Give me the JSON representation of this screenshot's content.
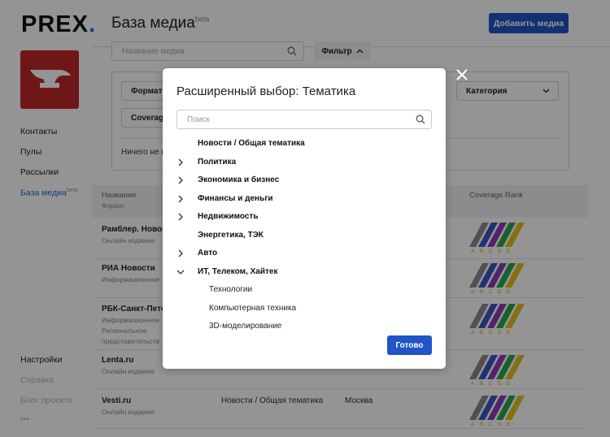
{
  "app": {
    "logo_text": "PREX",
    "logo_dot": ".",
    "page_title": "База медиа",
    "page_title_badge": "beta",
    "add_media_label": "Добавить медиа"
  },
  "sidebar": {
    "items": [
      {
        "label": "Контакты",
        "badge": ""
      },
      {
        "label": "Пулы",
        "badge": ""
      },
      {
        "label": "Рассылки",
        "badge": ""
      },
      {
        "label": "База медиа",
        "badge": "beta"
      }
    ],
    "bottom": [
      {
        "label": "Настройки"
      },
      {
        "label": "Справка"
      },
      {
        "label": "Блог проекта"
      },
      {
        "label": "•••"
      }
    ]
  },
  "search": {
    "placeholder": "Название медиа"
  },
  "filter_button": {
    "label": "Фильтр"
  },
  "filter_panel": {
    "format_label": "Формат",
    "coverage_label": "Coverage",
    "category_label": "Категория",
    "empty_text": "Ничего не в"
  },
  "table": {
    "col_name": "Название",
    "col_name_sub": "Формат",
    "col_rank": "Coverage Rank",
    "rank_letters": [
      "A",
      "B",
      "C",
      "D",
      "E"
    ],
    "rows": [
      {
        "name": "Рамблер. Новост",
        "sub": [
          "Онлайн издание"
        ],
        "theme": "",
        "city": ""
      },
      {
        "name": "РИА Новости",
        "sub": [
          "Информационное"
        ],
        "theme": "",
        "city": ""
      },
      {
        "name": "РБК-Санкт-Петер",
        "sub": [
          "Информационное",
          "Региональное",
          "представительств"
        ],
        "theme": "",
        "city": ""
      },
      {
        "name": "Lenta.ru",
        "sub": [
          "Онлайн издание"
        ],
        "theme": "",
        "city": ""
      },
      {
        "name": "Vesti.ru",
        "sub": [
          "Онлайн издание"
        ],
        "theme": "Новости / Общая тематика",
        "city": "Москва"
      }
    ]
  },
  "modal": {
    "title": "Расширенный выбор: Тематика",
    "search_placeholder": "Поиск",
    "items": [
      {
        "label": "Новости / Общая тематика",
        "chevron": "none"
      },
      {
        "label": "Политика",
        "chevron": "right"
      },
      {
        "label": "Экономика и бизнес",
        "chevron": "right"
      },
      {
        "label": "Финансы и деньги",
        "chevron": "right"
      },
      {
        "label": "Недвижимость",
        "chevron": "right"
      },
      {
        "label": "Энергетика, ТЭК",
        "chevron": "none"
      },
      {
        "label": "Авто",
        "chevron": "right"
      },
      {
        "label": "ИТ, Телеком, Хайтек",
        "chevron": "down"
      }
    ],
    "subitems": [
      {
        "label": "Технологии"
      },
      {
        "label": "Компьютерная техника"
      },
      {
        "label": "3D-моделирование"
      }
    ],
    "done_label": "Готово"
  },
  "colors": {
    "accent": "#1f55c7",
    "logo_bg": "#c0272b",
    "rank_stripes": [
      "#8a8a8a",
      "#3b55c9",
      "#8e3bb8",
      "#29a84a",
      "#e6c21e"
    ]
  }
}
